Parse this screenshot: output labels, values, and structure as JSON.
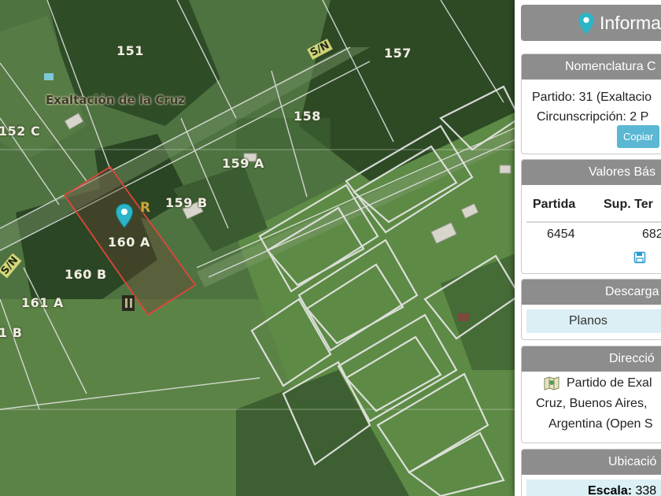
{
  "map": {
    "place_name": "Exaltación de la Cruz",
    "road_labels": [
      "S/N",
      "S/N"
    ],
    "lots": [
      {
        "label": "151"
      },
      {
        "label": "157"
      },
      {
        "label": "158"
      },
      {
        "label": "152 C"
      },
      {
        "label": "159 A"
      },
      {
        "label": "159 B"
      },
      {
        "label": "160 A"
      },
      {
        "label": "160 B"
      },
      {
        "label": "161 A"
      },
      {
        "label": "1 B"
      }
    ],
    "marker_letter": "R",
    "selected_lot": "160 A",
    "colors": {
      "selected_outline": "#e0453a",
      "parcel_line": "#e8e8e8",
      "pin": "#2bb5c7"
    }
  },
  "panel": {
    "title": "Informa",
    "nomenclatura": {
      "header": "Nomenclatura C",
      "partido": "Partido: 31 (Exaltacio",
      "circunscripcion": "Circunscripción: 2 P",
      "copy_label": "Copiar"
    },
    "valores": {
      "header": "Valores Bás",
      "col_partida": "Partida",
      "col_sup": "Sup. Ter",
      "partida_value": "6454",
      "sup_value": "682"
    },
    "descargas": {
      "header": "Descarga",
      "planos_label": "Planos"
    },
    "direccion": {
      "header": "Direcció",
      "line1": "Partido de Exal",
      "line2": "Cruz, Buenos Aires,",
      "line3": "Argentina (Open S"
    },
    "ubicacion": {
      "header": "Ubicació",
      "scale_label": "Escala:",
      "scale_value": "338"
    }
  }
}
